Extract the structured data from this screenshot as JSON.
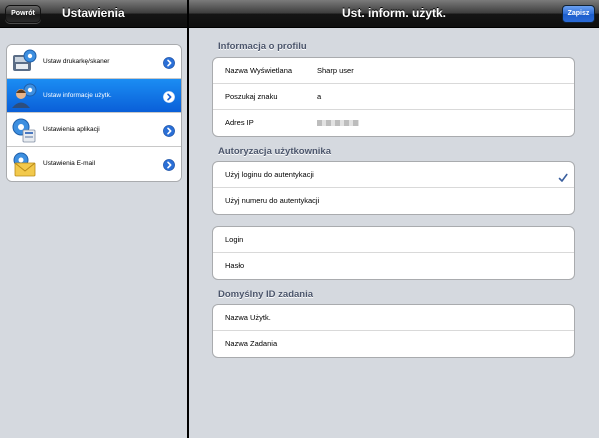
{
  "left": {
    "back_label": "Powrót",
    "title": "Ustawienia",
    "items": [
      {
        "label": "Ustaw drukarkę/skaner",
        "icon": "printer-gear-icon"
      },
      {
        "label": "Ustaw informacje użytk.",
        "icon": "user-gear-icon",
        "selected": true
      },
      {
        "label": "Ustawienia aplikacji",
        "icon": "app-gear-icon"
      },
      {
        "label": "Ustawienia E-mail",
        "icon": "email-gear-icon"
      }
    ]
  },
  "right": {
    "title": "Ust. inform. użytk.",
    "save_label": "Zapisz",
    "profile": {
      "header": "Informacja o profilu",
      "rows": [
        {
          "label": "Nazwa Wyświetlana",
          "value": "Sharp user"
        },
        {
          "label": "Poszukaj znaku",
          "value": "a"
        },
        {
          "label": "Adres IP",
          "value": ""
        }
      ]
    },
    "auth": {
      "header": "Autoryzacja użytkownika",
      "options": [
        {
          "label": "Użyj loginu do autentykacji",
          "checked": true
        },
        {
          "label": "Użyj numeru do autentykacji",
          "checked": false
        }
      ]
    },
    "credentials": {
      "rows": [
        {
          "label": "Login"
        },
        {
          "label": "Hasło"
        }
      ]
    },
    "job_id": {
      "header": "Domyślny ID zadania",
      "rows": [
        {
          "label": "Nazwa Użytk."
        },
        {
          "label": "Nazwa Zadania"
        }
      ]
    }
  },
  "colors": {
    "selection_blue": "#0a5fd8",
    "section_header": "#4c566c",
    "check_blue": "#3a5f9e",
    "background": "#d5d9df"
  }
}
